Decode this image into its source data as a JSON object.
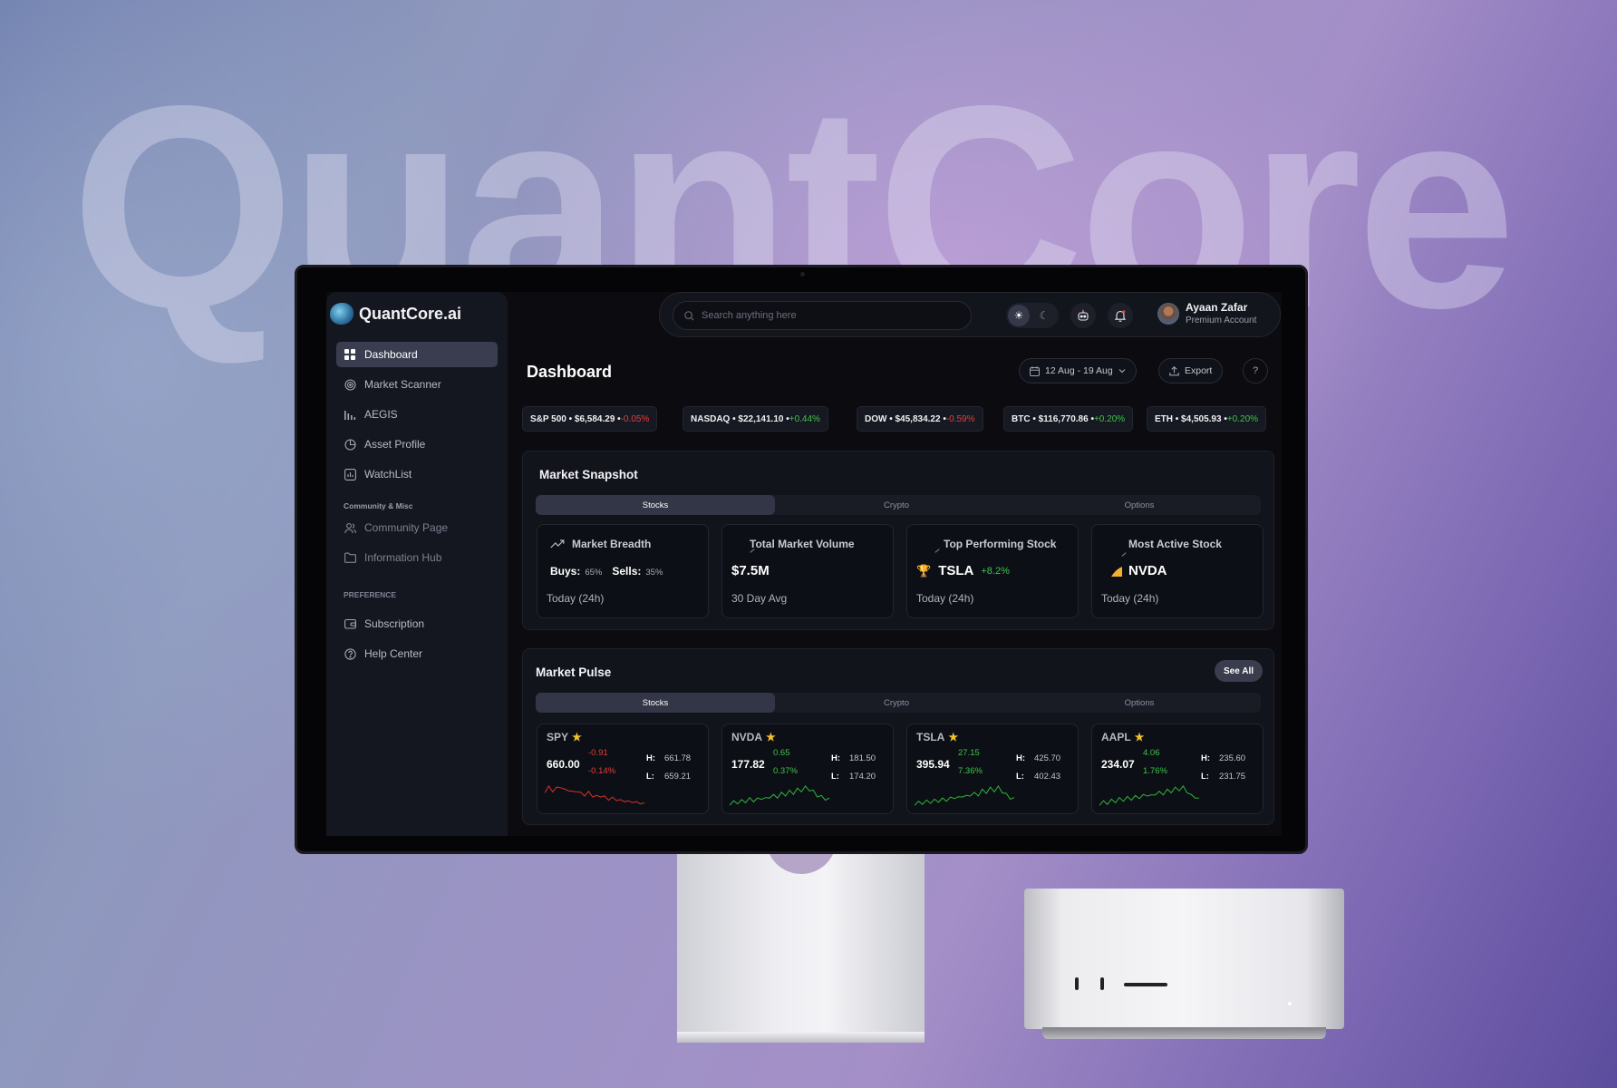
{
  "backdrop": {
    "word": "QuantCore"
  },
  "brand": {
    "name": "QuantCore.ai",
    "icon": "brain-logo-icon"
  },
  "sidebar": {
    "items": [
      {
        "label": "Dashboard",
        "icon": "grid-icon",
        "active": true
      },
      {
        "label": "Market Scanner",
        "icon": "radar-icon"
      },
      {
        "label": "AEGIS",
        "icon": "signal-bars-icon"
      },
      {
        "label": "Asset Profile",
        "icon": "pie-icon"
      },
      {
        "label": "WatchList",
        "icon": "chart-box-icon"
      }
    ],
    "section_community": "Community & Misc",
    "community_items": [
      {
        "label": "Community Page",
        "icon": "users-icon"
      },
      {
        "label": "Information Hub",
        "icon": "folder-icon"
      }
    ],
    "section_preference": "PREFERENCE",
    "preference_items": [
      {
        "label": "Subscription",
        "icon": "wallet-icon"
      },
      {
        "label": "Help Center",
        "icon": "question-icon"
      }
    ]
  },
  "topbar": {
    "search_placeholder": "Search anything here",
    "user": {
      "name": "Ayaan Zafar",
      "plan": "Premium Account"
    }
  },
  "header": {
    "title": "Dashboard",
    "date_range": "12 Aug - 19 Aug",
    "export_label": "Export",
    "help_label": "?"
  },
  "tickers": [
    {
      "text": "S&P 500 • $6,584.29 • ",
      "change": "-0.05%",
      "dir": "neg"
    },
    {
      "text": "NASDAQ • $22,141.10 • ",
      "change": "+0.44%",
      "dir": "pos"
    },
    {
      "text": "DOW • $45,834.22 • ",
      "change": "-0.59%",
      "dir": "neg"
    },
    {
      "text": "BTC • $116,770.86 • ",
      "change": "+0.20%",
      "dir": "pos"
    },
    {
      "text": "ETH • $4,505.93 • ",
      "change": "+0.20%",
      "dir": "pos"
    }
  ],
  "snapshot": {
    "title": "Market Snapshot",
    "tabs": [
      "Stocks",
      "Crypto",
      "Options"
    ],
    "breadth": {
      "title": "Market Breadth",
      "buys_label": "Buys:",
      "buys": "65%",
      "sells_label": "Sells:",
      "sells": "35%",
      "sub": "Today (24h)"
    },
    "volume": {
      "title": "Total Market Volume",
      "value": "$7.5M",
      "sub": "30 Day Avg"
    },
    "top": {
      "title": "Top Performing Stock",
      "symbol": "TSLA",
      "change": "+8.2%",
      "sub": "Today (24h)"
    },
    "active": {
      "title": "Most Active Stock",
      "symbol": "NVDA",
      "sub": "Today (24h)"
    }
  },
  "pulse": {
    "title": "Market Pulse",
    "see_all": "See All",
    "tabs": [
      "Stocks",
      "Crypto",
      "Options"
    ],
    "cards": [
      {
        "symbol": "SPY",
        "price": "660.00",
        "chg": "-0.91",
        "pct": "-0.14%",
        "dir": "neg",
        "high": "661.78",
        "low": "659.21",
        "color": "#d8322c"
      },
      {
        "symbol": "NVDA",
        "price": "177.82",
        "chg": "0.65",
        "pct": "0.37%",
        "dir": "pos",
        "high": "181.50",
        "low": "174.20",
        "color": "#2fb53a"
      },
      {
        "symbol": "TSLA",
        "price": "395.94",
        "chg": "27.15",
        "pct": "7.36%",
        "dir": "pos",
        "high": "425.70",
        "low": "402.43",
        "color": "#2fb53a"
      },
      {
        "symbol": "AAPL",
        "price": "234.07",
        "chg": "4.06",
        "pct": "1.76%",
        "dir": "pos",
        "high": "235.60",
        "low": "231.75",
        "color": "#2fb53a"
      }
    ],
    "hl_labels": {
      "high": "H:",
      "low": "L:"
    }
  }
}
